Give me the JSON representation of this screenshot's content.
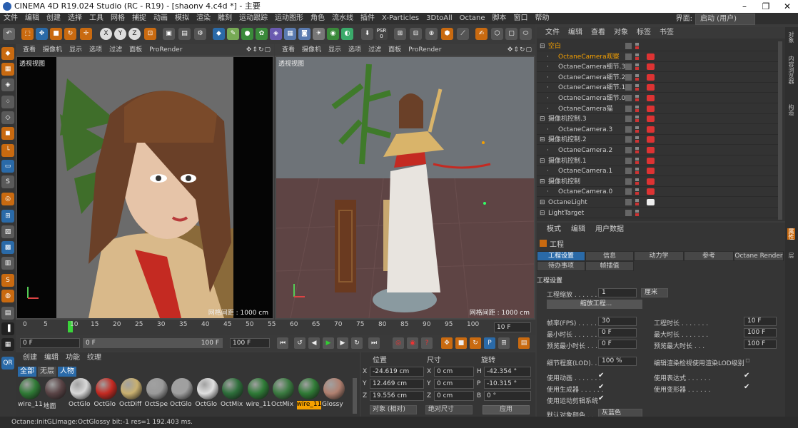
{
  "window": {
    "title": "CINEMA 4D R19.024 Studio (RC - R19) - [shaonv 4.c4d *] - 主要",
    "min": "–",
    "max": "❐",
    "close": "✕"
  },
  "menu": [
    "文件",
    "编辑",
    "创建",
    "选择",
    "工具",
    "网格",
    "捕捉",
    "动画",
    "模拟",
    "渲染",
    "雕刻",
    "运动跟踪",
    "运动图形",
    "角色",
    "流水线",
    "插件",
    "X-Particles",
    "3DtoAll",
    "Octane",
    "脚本",
    "窗口",
    "帮助"
  ],
  "layout": {
    "label": "界面:",
    "value": "启动 (用户)"
  },
  "toolbar_icons": [
    "undo-icon",
    "move-icon",
    "scale-icon",
    "rotate-icon",
    "select-icon",
    "x-axis-icon",
    "y-axis-icon",
    "z-axis-icon",
    "coord-icon",
    "render-view-icon",
    "render-icon",
    "render-settings-icon",
    "cube-icon",
    "pen-icon",
    "subdivide-icon",
    "array-icon",
    "deformer-icon",
    "scene-icon",
    "camera-icon",
    "light-icon",
    "material-icon",
    "psr-icon"
  ],
  "toolbar_labels": {
    "x": "X",
    "y": "Y",
    "z": "Z",
    "psr": "PSR",
    "psr_val": "0"
  },
  "viewport_menu": [
    "查看",
    "摄像机",
    "显示",
    "选项",
    "过滤",
    "面板",
    "ProRender"
  ],
  "viewport_left": {
    "label": "透视视图",
    "grid": "网格间距 : 1000 cm"
  },
  "viewport_right": {
    "label": "透视视图",
    "grid": "网格间距 : 1000 cm"
  },
  "timeline": {
    "ticks": [
      "0",
      "5",
      "10",
      "15",
      "20",
      "25",
      "30",
      "35",
      "40",
      "45",
      "50",
      "55",
      "60",
      "65",
      "70",
      "75",
      "80",
      "85",
      "90",
      "95",
      "100"
    ],
    "current": "10 F"
  },
  "playbar": {
    "start": "0 F",
    "min": "0 F",
    "max": "100 F",
    "end": "100 F"
  },
  "materials": {
    "menu": [
      "创建",
      "编辑",
      "功能",
      "纹理"
    ],
    "tabs": [
      "全部",
      "无层",
      "人物"
    ],
    "items": [
      {
        "name": "wire_11",
        "color": "#2f7a35"
      },
      {
        "name": "地面",
        "color": "#5a4446"
      },
      {
        "name": "OctGlo",
        "color": "#d8d8d8"
      },
      {
        "name": "OctGlo",
        "color": "#c42a22"
      },
      {
        "name": "OctDiff",
        "color": "#c9b070"
      },
      {
        "name": "OctSpe",
        "color": "#9a9a9a"
      },
      {
        "name": "OctGlo",
        "color": "#a0a0a0"
      },
      {
        "name": "OctGlo",
        "color": "#e0e0e0"
      },
      {
        "name": "OctMix",
        "color": "#2d6e3a"
      },
      {
        "name": "wire_11",
        "color": "#2e7a36"
      },
      {
        "name": "OctMix",
        "color": "#3a7a40"
      },
      {
        "name": "wire_11",
        "color": "#2f7a35"
      },
      {
        "name": "Glossy",
        "color": "#b08070"
      }
    ]
  },
  "coords": {
    "h_pos": "位置",
    "h_size": "尺寸",
    "h_rot": "旋转",
    "x": "X",
    "y": "Y",
    "z": "Z",
    "sx": "X",
    "sy": "Y",
    "sz": "Z",
    "h": "H",
    "p": "P",
    "b": "B",
    "px": "-24.619 cm",
    "py": "12.469 cm",
    "pz": "19.556 cm",
    "sxv": "0 cm",
    "syv": "0 cm",
    "szv": "0 cm",
    "hv": "-42.354 °",
    "pv": "-10.315 °",
    "bv": "0 °",
    "mode": "对象 (相对)",
    "size_mode": "绝对尺寸",
    "apply": "应用"
  },
  "objects": {
    "menu": [
      "文件",
      "编辑",
      "查看",
      "对象",
      "标签",
      "书签"
    ],
    "rows": [
      {
        "name": "空白",
        "indent": 0,
        "color": "#f5a000"
      },
      {
        "name": "OctaneCamera观察",
        "indent": 1,
        "color": "#f5a000"
      },
      {
        "name": "OctaneCamera细节.3",
        "indent": 1,
        "color": "#ccc"
      },
      {
        "name": "OctaneCamera细节.2",
        "indent": 1,
        "color": "#ccc"
      },
      {
        "name": "OctaneCamera细节.1",
        "indent": 1,
        "color": "#ccc"
      },
      {
        "name": "OctaneCamera细节.0",
        "indent": 1,
        "color": "#ccc"
      },
      {
        "name": "OctaneCamera猫",
        "indent": 1,
        "color": "#ccc"
      },
      {
        "name": "摄像机控制.3",
        "indent": 0,
        "color": "#ccc"
      },
      {
        "name": "OctaneCamera.3",
        "indent": 1,
        "color": "#ccc"
      },
      {
        "name": "摄像机控制.2",
        "indent": 0,
        "color": "#ccc"
      },
      {
        "name": "OctaneCamera.2",
        "indent": 1,
        "color": "#ccc"
      },
      {
        "name": "摄像机控制.1",
        "indent": 0,
        "color": "#ccc"
      },
      {
        "name": "OctaneCamera.1",
        "indent": 1,
        "color": "#ccc"
      },
      {
        "name": "摄像机控制",
        "indent": 0,
        "color": "#ccc"
      },
      {
        "name": "OctaneCamera.0",
        "indent": 1,
        "color": "#ccc"
      },
      {
        "name": "OctaneLight",
        "indent": 0,
        "color": "#ccc"
      },
      {
        "name": "LightTarget",
        "indent": 0,
        "color": "#ccc"
      }
    ]
  },
  "attributes": {
    "menu": [
      "模式",
      "编辑",
      "用户数据"
    ],
    "title": "工程",
    "tabs": [
      "工程设置",
      "信息",
      "动力学",
      "参考",
      "Octane Render",
      "待办事项",
      "帧插值"
    ],
    "section": "工程设置",
    "scale_label": "工程缩放 . . . . . .",
    "scale_val": "1",
    "scale_unit": "厘米",
    "scale_btn": "缩放工程...",
    "fps_label": "帧率(FPS) . . . . . .",
    "fps": "30",
    "dur_label": "工程时长 . . . . . . .",
    "dur": "10 F",
    "min_label": "最小时长 . . . . . . .",
    "min": "0 F",
    "max_label": "最大时长 . . . . . . .",
    "max": "100 F",
    "pmin_label": "预览最小时长 . . .",
    "pmin": "0 F",
    "pmax_label": "预览最大时长 . . .",
    "pmax": "100 F",
    "lod_label": "细节程度(LOD). . .",
    "lod": "100 %",
    "lod_edit": "编辑渲染检视使用渲染LOD级别",
    "anim": "使用动画 . . . . . . .",
    "expr": "使用表达式 . . . . . .",
    "gen": "使用生成器 . . . . . .",
    "deform": "使用变形器 . . . . . .",
    "motion": "使用运动剪辑系统",
    "color_label": "默认对象颜色 . .",
    "color_val": "灰蓝色",
    "check": "✔"
  },
  "right_strip": [
    "对象",
    "内容浏览器",
    "构造",
    "属性",
    "层"
  ],
  "status": "Octane:InitGLImage:OctGlossy  bit:-1 res=1  192.403 ms."
}
